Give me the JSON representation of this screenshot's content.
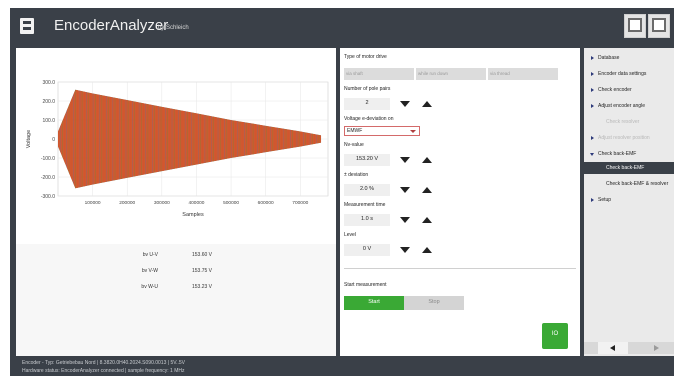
{
  "header": {
    "title": "EncoderAnalyzer",
    "subtitle": "by Schleich",
    "buttons": [
      {
        "icon": "document-report-icon",
        "caption": "Report"
      },
      {
        "icon": "settings-window-icon",
        "caption": "Settings"
      }
    ]
  },
  "chart_data": {
    "type": "area",
    "title": "",
    "xlabel": "Samples",
    "ylabel": "Voltage",
    "ylim": [
      -300,
      300
    ],
    "xlim": [
      0,
      780000
    ],
    "yticks": [
      "300.0",
      "200.0",
      "100.0",
      "0",
      "-100.0",
      "-200.0",
      "-300.0"
    ],
    "xticks": [
      "100000",
      "200000",
      "300000",
      "400000",
      "500000",
      "600000",
      "700000"
    ],
    "grid": true,
    "series": [
      {
        "color": "#e8471d",
        "x": [
          0,
          50000,
          100000,
          200000,
          300000,
          400000,
          500000,
          600000,
          700000,
          760000
        ],
        "envelope": [
          40,
          260,
          240,
          205,
          170,
          135,
          100,
          70,
          40,
          20
        ]
      },
      {
        "color": "#2a7ad8",
        "x": [
          0,
          50000,
          100000,
          200000,
          300000,
          400000,
          500000,
          600000,
          700000,
          760000
        ],
        "envelope": [
          40,
          260,
          240,
          205,
          170,
          135,
          100,
          70,
          40,
          20
        ]
      },
      {
        "color": "#39a83a",
        "x": [
          0,
          50000,
          100000,
          200000,
          300000,
          400000,
          500000,
          600000,
          700000,
          760000
        ],
        "envelope": [
          40,
          260,
          240,
          205,
          170,
          135,
          100,
          70,
          40,
          20
        ]
      }
    ]
  },
  "readings": [
    {
      "label": "bv U-V",
      "value": "153.60 V"
    },
    {
      "label": "bv V-W",
      "value": "153.75 V"
    },
    {
      "label": "bv W-U",
      "value": "153.23 V"
    }
  ],
  "settings": {
    "motor_drive_label": "Type of motor drive",
    "motor_drive_options": [
      "via shaft",
      "while run down",
      "via thread"
    ],
    "pole_pairs_label": "Number of pole pairs",
    "pole_pairs_value": "2",
    "voltage_deviation_label": "Voltage e-deviation on",
    "voltage_deviation_value": "EMWF",
    "nv_value_label": "Nv-value",
    "nv_value": "153.20 V",
    "deviation_label": "± deviation",
    "deviation_value": "2.0 %",
    "measurement_time_label": "Measurement time",
    "measurement_time_value": "1.0 s",
    "level_label": "Level",
    "level_value": "0 V",
    "start_measurement_label": "Start measurement",
    "start_label": "Start",
    "stop_label": "Stop",
    "io_label": "IO"
  },
  "nav": {
    "items": [
      {
        "label": "Database",
        "state": "normal"
      },
      {
        "label": "Encoder data settings",
        "state": "normal"
      },
      {
        "label": "Check encoder",
        "state": "normal"
      },
      {
        "label": "Adjust encoder angle",
        "state": "normal"
      },
      {
        "label": "Check resolver",
        "state": "disabled-sub"
      },
      {
        "label": "Adjust resolver position",
        "state": "disabled"
      },
      {
        "label": "Check back-EMF",
        "state": "expanded"
      },
      {
        "label": "Check back-EMF",
        "state": "active-sub"
      },
      {
        "label": "Check back-EMF & resolver",
        "state": "sub"
      },
      {
        "label": "Setup",
        "state": "normal"
      }
    ]
  },
  "status": {
    "line1": "Encoder - Typ: Getriebebau Nord | 8.3820.0H40.2024.S090.0013 | 5V..5V",
    "line2": "Hardware status: EncoderAnalyzer connected | sample frequency: 1 MHz"
  },
  "colors": {
    "accent_green": "#3aa935",
    "header_bg": "#3a4048",
    "nav_bg": "#eaeaea"
  }
}
